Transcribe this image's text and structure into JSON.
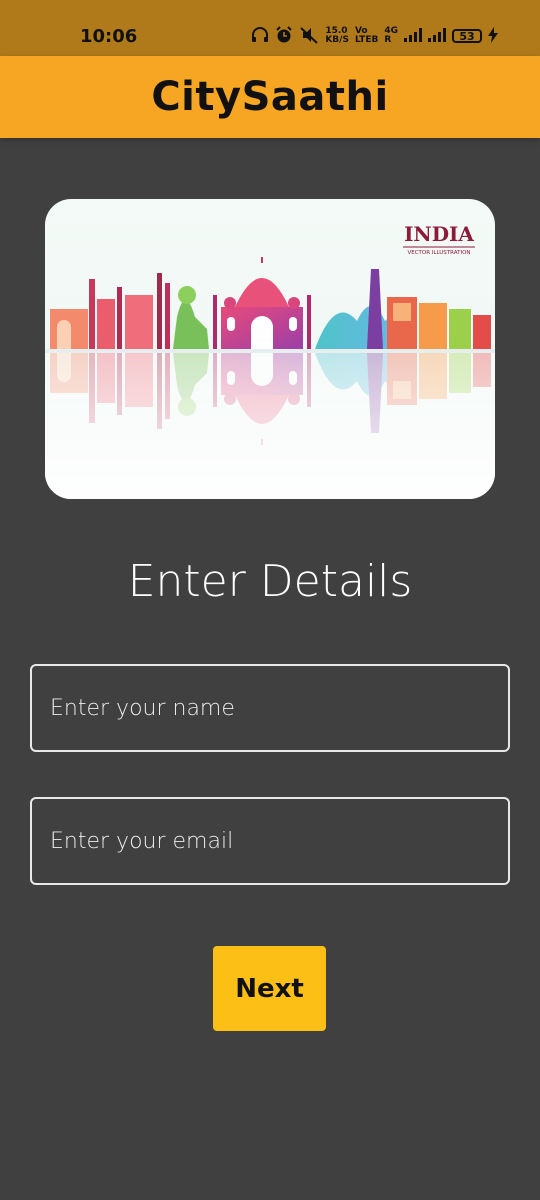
{
  "status_bar": {
    "time": "10:06",
    "speed_value": "15.0",
    "speed_unit": "KB/S",
    "volte_top": "Vo",
    "volte_bottom": "LTEB",
    "network_top": "4G",
    "network_bottom": "R",
    "battery": "53",
    "icons": [
      "headphones-icon",
      "alarm-icon",
      "mute-icon",
      "wifi-icon",
      "signal-icon",
      "signal-icon",
      "battery-icon",
      "charging-icon"
    ]
  },
  "appbar": {
    "title": "CitySaathi"
  },
  "hero": {
    "brand_title": "INDIA",
    "brand_subtitle": "VECTOR ILLUSTRATION"
  },
  "form": {
    "heading": "Enter Details",
    "name_placeholder": "Enter your name",
    "email_placeholder": "Enter your email",
    "next_label": "Next"
  },
  "colors": {
    "status_bar": "#b07a1a",
    "app_bar": "#f6a623",
    "background": "#404040",
    "button": "#fbbf16"
  }
}
